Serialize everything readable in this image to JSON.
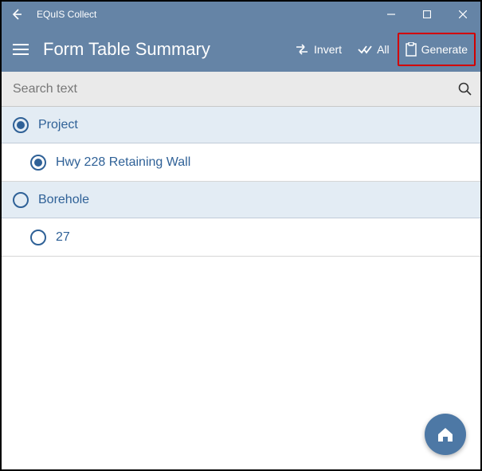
{
  "window": {
    "title": "EQuIS Collect"
  },
  "toolbar": {
    "page_title": "Form Table Summary",
    "invert_label": "Invert",
    "all_label": "All",
    "generate_label": "Generate"
  },
  "search": {
    "placeholder": "Search text"
  },
  "groups": [
    {
      "name": "Project",
      "selected": true,
      "items": [
        {
          "label": "Hwy 228 Retaining Wall",
          "selected": true
        }
      ]
    },
    {
      "name": "Borehole",
      "selected": false,
      "items": [
        {
          "label": "27",
          "selected": false
        }
      ]
    }
  ],
  "colors": {
    "accent": "#6584a6",
    "link": "#2f6197",
    "highlight": "#d20000"
  }
}
